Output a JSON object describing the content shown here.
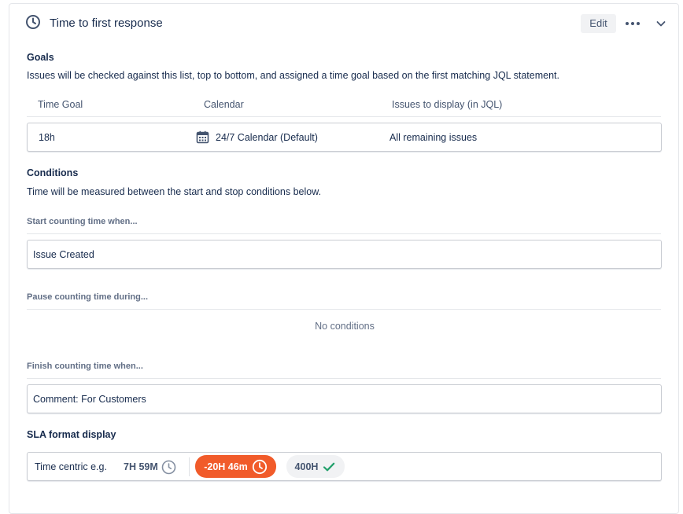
{
  "header": {
    "title": "Time to first response",
    "edit_label": "Edit",
    "icons": {
      "clock": "clock-icon",
      "more": "more-horizontal-icon",
      "collapse": "chevron-down-icon"
    }
  },
  "goals": {
    "title": "Goals",
    "description": "Issues will be checked against this list, top to bottom, and assigned a time goal based on the first matching JQL statement.",
    "columns": [
      "Time Goal",
      "Calendar",
      "Issues to display (in JQL)"
    ],
    "rows": [
      {
        "time_goal": "18h",
        "calendar": "24/7 Calendar (Default)",
        "jql": "All remaining issues"
      }
    ]
  },
  "conditions": {
    "title": "Conditions",
    "description": "Time will be measured between the start and stop conditions below.",
    "start": {
      "label": "Start counting time when...",
      "value": "Issue Created"
    },
    "pause": {
      "label": "Pause counting time during...",
      "empty_text": "No conditions"
    },
    "finish": {
      "label": "Finish counting time when...",
      "value": "Comment: For Customers"
    }
  },
  "sla_format": {
    "title": "SLA format display",
    "label": "Time centric e.g.",
    "examples": [
      {
        "text": "7H 59M",
        "icon": "clock-icon",
        "state": "running"
      },
      {
        "text": "-20H 46m",
        "icon": "clock-icon",
        "state": "breached",
        "color": "#f15b2a"
      },
      {
        "text": "400H",
        "icon": "check-icon",
        "state": "met",
        "color": "#22a06b"
      }
    ]
  }
}
